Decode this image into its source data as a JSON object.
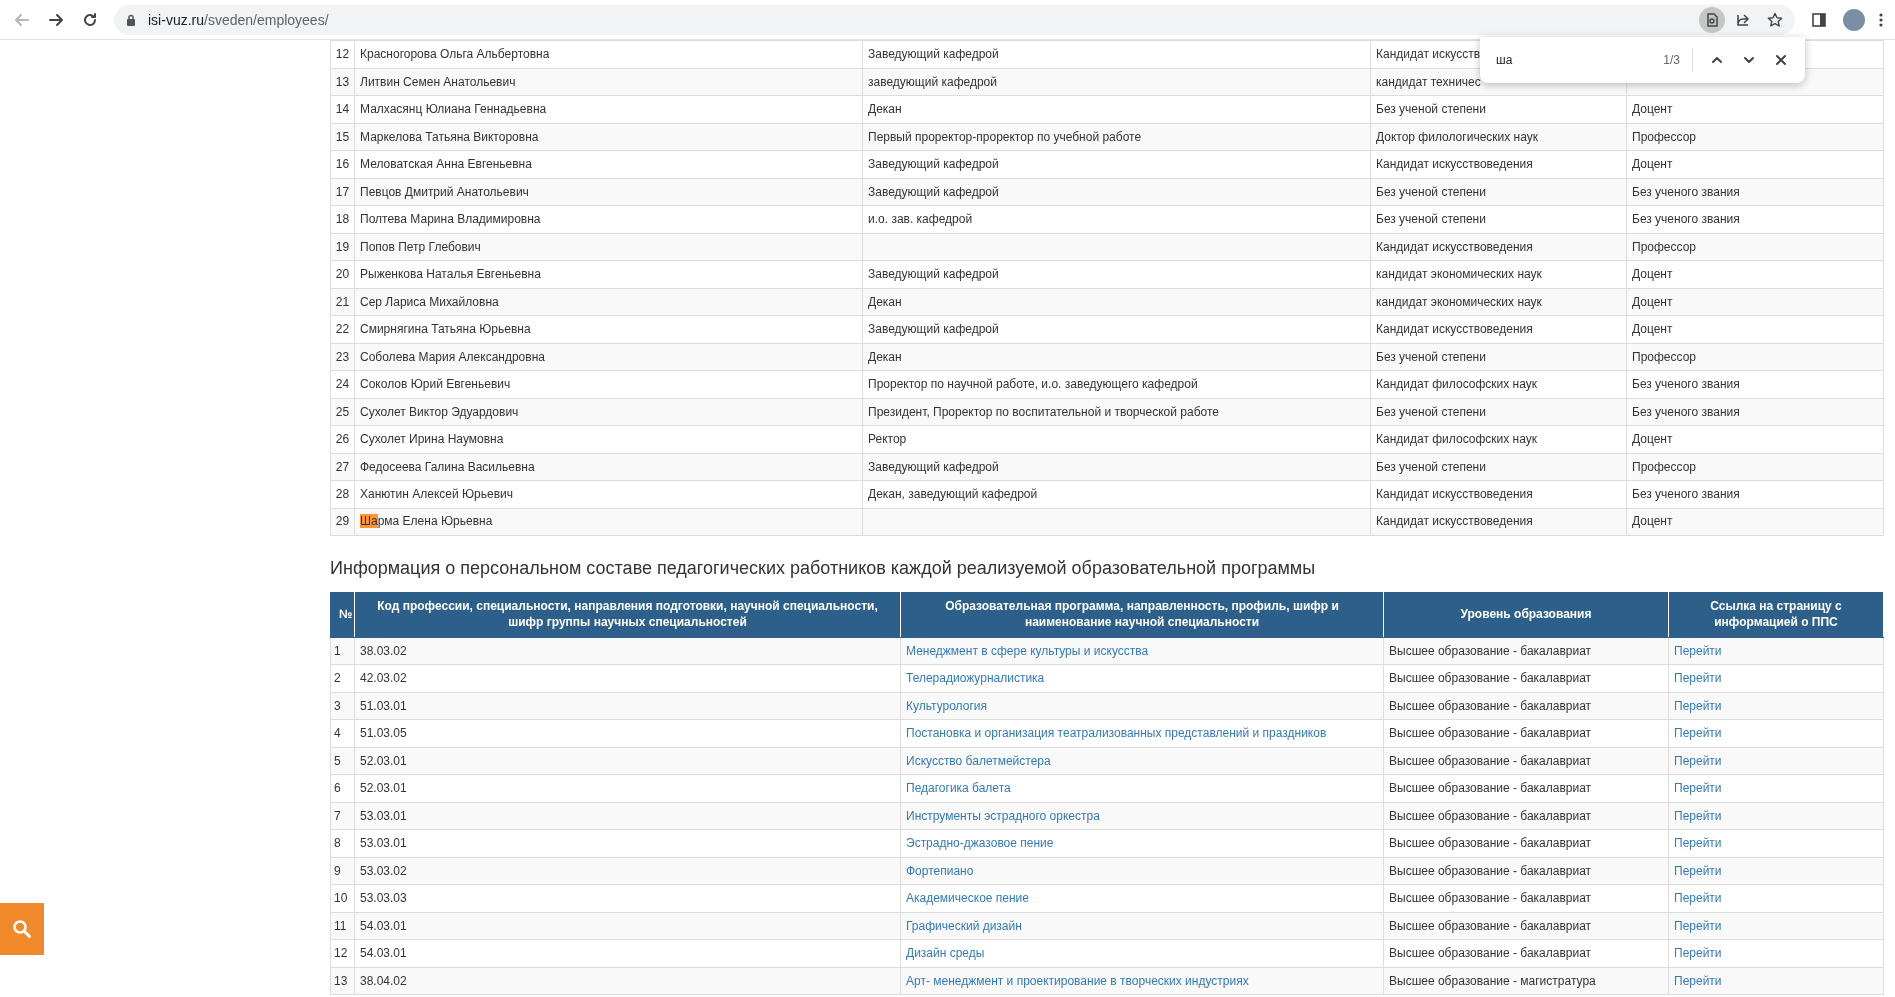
{
  "browser": {
    "back_disabled": true,
    "url_host": "isi-vuz.ru",
    "url_path": "/sveden/employees/",
    "find_active": true
  },
  "find_bar": {
    "query": "ша",
    "count": "1/3"
  },
  "staff_table": {
    "rows": [
      {
        "num": "12",
        "name": [
          {
            "text": "Красногорова Ольга Альбертовна",
            "match": false
          }
        ],
        "position": "Заведующий кафедрой",
        "degree": "Кандидат искусств"
      },
      {
        "num": "13",
        "name": [
          {
            "text": "Литвин Семен Анатольевич",
            "match": false
          }
        ],
        "position": "заведующий кафедрой",
        "degree": "кандидат техничес"
      },
      {
        "num": "14",
        "name": [
          {
            "text": "Малхасянц Юлиана Геннадьевна",
            "match": false
          }
        ],
        "position": "Декан",
        "degree": "Без ученой степени",
        "title": "Доцент"
      },
      {
        "num": "15",
        "name": [
          {
            "text": "Маркелова Татьяна Викторовна",
            "match": false
          }
        ],
        "position": "Первый проректор-проректор по учебной работе",
        "degree": "Доктор филологических наук",
        "title": "Профессор"
      },
      {
        "num": "16",
        "name": [
          {
            "text": "Меловатская Анна Евгеньевна",
            "match": false
          }
        ],
        "position": "Заведующий кафедрой",
        "degree": "Кандидат искусствоведения",
        "title": "Доцент"
      },
      {
        "num": "17",
        "name": [
          {
            "text": "Певцов Дмитрий Анатольевич",
            "match": false
          }
        ],
        "position": "Заведующий кафедрой",
        "degree": "Без ученой степени",
        "title": "Без ученого звания"
      },
      {
        "num": "18",
        "name": [
          {
            "text": "Полтева Марина Владимировна",
            "match": false
          }
        ],
        "position": "и.о. зав. кафедрой",
        "degree": "Без ученой степени",
        "title": "Без ученого звания"
      },
      {
        "num": "19",
        "name": [
          {
            "text": "Попов Петр Глебович",
            "match": false
          }
        ],
        "degree": "Кандидат искусствоведения",
        "title": "Профессор"
      },
      {
        "num": "20",
        "name": [
          {
            "text": "Рыженкова Наталья Евгеньевна",
            "match": false
          }
        ],
        "position": "Заведующий кафедрой",
        "degree": "кандидат экономических наук",
        "title": "Доцент"
      },
      {
        "num": "21",
        "name": [
          {
            "text": "Сер Лариса Михайловна",
            "match": false
          }
        ],
        "position": "Декан",
        "degree": "кандидат экономических наук",
        "title": "Доцент"
      },
      {
        "num": "22",
        "name": [
          {
            "text": "Смирнягина Татьяна Юрьевна",
            "match": false
          }
        ],
        "position": "Заведующий кафедрой",
        "degree": "Кандидат искусствоведения",
        "title": "Доцент"
      },
      {
        "num": "23",
        "name": [
          {
            "text": "Соболева Мария Александровна",
            "match": false
          }
        ],
        "position": "Декан",
        "degree": "Без ученой степени",
        "title": "Профессор"
      },
      {
        "num": "24",
        "name": [
          {
            "text": "Соколов Юрий Евгеньевич",
            "match": false
          }
        ],
        "position": "Проректор по научной работе, и.о. заведующего кафедрой",
        "degree": "Кандидат философских наук",
        "title": "Без ученого звания"
      },
      {
        "num": "25",
        "name": [
          {
            "text": "Сухолет Виктор Эдуардович",
            "match": false
          }
        ],
        "position": "Президент, Проректор по воспитательной и творческой работе",
        "degree": "Без ученой степени",
        "title": "Без ученого звания"
      },
      {
        "num": "26",
        "name": [
          {
            "text": "Сухолет Ирина Наумовна",
            "match": false
          }
        ],
        "position": "Ректор",
        "degree": "Кандидат философских наук",
        "title": "Доцент"
      },
      {
        "num": "27",
        "name": [
          {
            "text": "Федосеева Галина Васильевна",
            "match": false
          }
        ],
        "position": "Заведующий кафедрой",
        "degree": "Без ученой степени",
        "title": "Профессор"
      },
      {
        "num": "28",
        "name": [
          {
            "text": "Ханютин Алексей Юрьевич",
            "match": false
          }
        ],
        "position": "Декан, заведующий кафедрой",
        "degree": "Кандидат искусствоведения",
        "title": "Без ученого звания"
      },
      {
        "num": "29",
        "name": [
          {
            "text": "Ша",
            "match": true
          },
          {
            "text": "рма Елена Юрьевна",
            "match": false
          }
        ],
        "degree": "Кандидат искусствоведения",
        "title": "Доцент"
      }
    ]
  },
  "programs_section": {
    "heading": "Информация о персональном составе педагогических работников каждой реализуемой образовательной программы",
    "columns": [
      "№",
      "Код профессии, специальности, направления подготовки, научной специальности, шифр группы научных специальностей",
      "Образовательная программа, направленность, профиль, шифр и наименование научной специальности",
      "Уровень образования",
      "Ссылка на страницу с информацией о ППС"
    ],
    "rows": [
      {
        "num": "1",
        "code": "38.03.02",
        "program": "Менеджмент в сфере культуры и искусства",
        "level": "Высшее образование - бакалавриат",
        "link": "Перейти"
      },
      {
        "num": "2",
        "code": "42.03.02",
        "program": "Телерадиожурналистика",
        "level": "Высшее образование - бакалавриат",
        "link": "Перейти"
      },
      {
        "num": "3",
        "code": "51.03.01",
        "program": "Культурология",
        "level": "Высшее образование - бакалавриат",
        "link": "Перейти"
      },
      {
        "num": "4",
        "code": "51.03.05",
        "program": "Постановка и организация театрализованных представлений и праздников",
        "level": "Высшее образование - бакалавриат",
        "link": "Перейти"
      },
      {
        "num": "5",
        "code": "52.03.01",
        "program": "Искусство балетмейстера",
        "level": "Высшее образование - бакалавриат",
        "link": "Перейти"
      },
      {
        "num": "6",
        "code": "52.03.01",
        "program": "Педагогика балета",
        "level": "Высшее образование - бакалавриат",
        "link": "Перейти"
      },
      {
        "num": "7",
        "code": "53.03.01",
        "program": "Инструменты эстрадного оркестра",
        "level": "Высшее образование - бакалавриат",
        "link": "Перейти"
      },
      {
        "num": "8",
        "code": "53.03.01",
        "program": "Эстрадно-джазовое пение",
        "level": "Высшее образование - бакалавриат",
        "link": "Перейти"
      },
      {
        "num": "9",
        "code": "53.03.02",
        "program": "Фортепиано",
        "level": "Высшее образование - бакалавриат",
        "link": "Перейти"
      },
      {
        "num": "10",
        "code": "53.03.03",
        "program": "Академическое пение",
        "level": "Высшее образование - бакалавриат",
        "link": "Перейти"
      },
      {
        "num": "11",
        "code": "54.03.01",
        "program": "Графический дизайн",
        "level": "Высшее образование - бакалавриат",
        "link": "Перейти"
      },
      {
        "num": "12",
        "code": "54.03.01",
        "program": "Дизайн среды",
        "level": "Высшее образование - бакалавриат",
        "link": "Перейти"
      },
      {
        "num": "13",
        "code": "38.04.02",
        "program": "Арт- менеджмент и проектирование в творческих индустриях",
        "level": "Высшее образование - магистратура",
        "link": "Перейти"
      }
    ]
  }
}
